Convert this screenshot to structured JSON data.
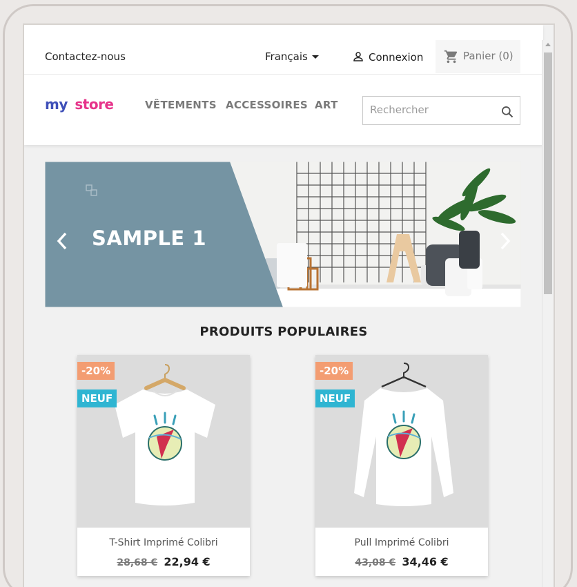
{
  "header": {
    "contact": "Contactez-nous",
    "language": "Français",
    "login": "Connexion",
    "cart": "Panier (0)",
    "logo": {
      "parts": [
        "my",
        "store"
      ]
    },
    "menu": [
      "VÊTEMENTS",
      "ACCESSOIRES",
      "ART"
    ],
    "search": {
      "placeholder": "Rechercher"
    }
  },
  "slider": {
    "title": "SAMPLE 1",
    "panel_color": "#7594a3"
  },
  "popular": {
    "title": "PRODUITS POPULAIRES",
    "products": [
      {
        "name": "T-Shirt Imprimé Colibri",
        "discount": "-20%",
        "badge": "NEUF",
        "old_price": "28,68 €",
        "price": "22,94 €"
      },
      {
        "name": "Pull Imprimé Colibri",
        "discount": "-20%",
        "badge": "NEUF",
        "old_price": "43,08 €",
        "price": "34,46 €"
      }
    ]
  },
  "colors": {
    "discount": "#f39d72",
    "new": "#2fb5d2",
    "accent": "#7594a3"
  }
}
